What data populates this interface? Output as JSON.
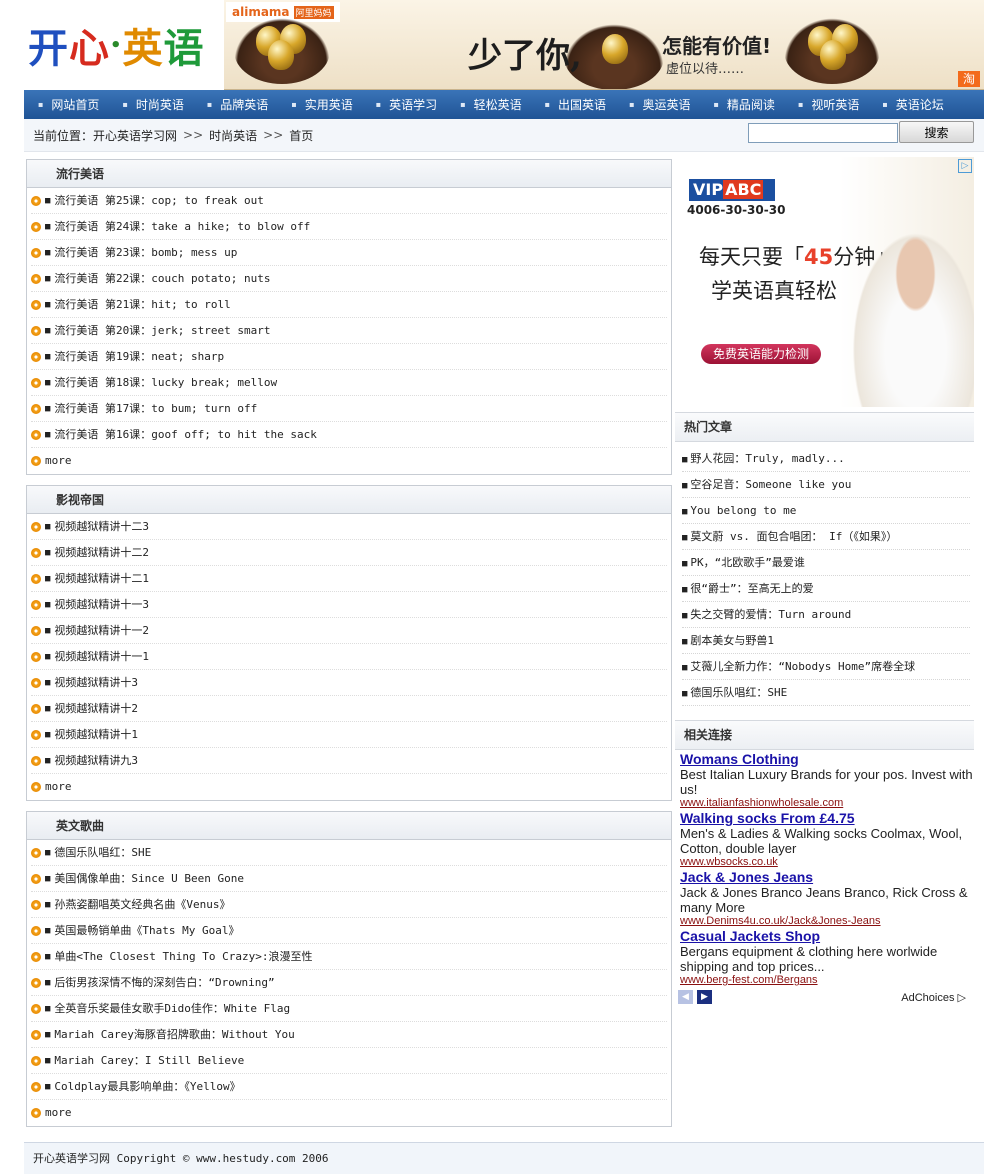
{
  "header": {
    "logo_chars": [
      "开",
      "心",
      "•",
      "英",
      "语"
    ],
    "logo_colors": [
      "#1f4fbf",
      "#d62b1e",
      "#2a8a2a",
      "#e08a00",
      "#1f9a3a"
    ],
    "banner": {
      "alimama": "alimama",
      "alimama_sub": "阿里妈妈",
      "slogan_main": "少了你,",
      "slogan_side": "怎能有价值!",
      "slogan_sub": "虚位以待……",
      "taobao_badge": "淘"
    }
  },
  "nav": [
    "网站首页",
    "时尚英语",
    "品牌英语",
    "实用英语",
    "英语学习",
    "轻松英语",
    "出国英语",
    "奥运英语",
    "精品阅读",
    "视听英语",
    "英语论坛"
  ],
  "location": {
    "label": "当前位置：",
    "crumbs": [
      "开心英语学习网",
      "时尚英语",
      "首页"
    ],
    "separator": ">>",
    "search_button": "搜索",
    "search_value": ""
  },
  "sections": [
    {
      "title": "流行美语",
      "items": [
        "流行美语 第25课：cop; to freak out",
        "流行美语 第24课：take a hike; to blow off",
        "流行美语 第23课：bomb; mess up",
        "流行美语 第22课：couch potato; nuts",
        "流行美语 第21课：hit; to roll",
        "流行美语 第20课：jerk; street smart",
        "流行美语 第19课：neat; sharp",
        "流行美语 第18课：lucky break; mellow",
        "流行美语 第17课：to bum; turn off",
        "流行美语 第16课：goof off; to hit the sack"
      ],
      "more": "more"
    },
    {
      "title": "影视帝国",
      "items": [
        "视频越狱精讲十二3",
        "视频越狱精讲十二2",
        "视频越狱精讲十二1",
        "视频越狱精讲十一3",
        "视频越狱精讲十一2",
        "视频越狱精讲十一1",
        "视频越狱精讲十3",
        "视频越狱精讲十2",
        "视频越狱精讲十1",
        "视频越狱精讲九3"
      ],
      "more": "more"
    },
    {
      "title": "英文歌曲",
      "items": [
        "德国乐队唱红：SHE",
        "美国偶像单曲：Since U Been Gone",
        "孙燕姿翻唱英文经典名曲《Venus》",
        "英国最畅销单曲《Thats My Goal》",
        "单曲<The Closest Thing To Crazy>:浪漫至性",
        "后街男孩深情不悔的深刻告白：“Drowning”",
        "全英音乐奖最佳女歌手Dido佳作：White Flag",
        "Mariah Carey海豚音招牌歌曲：Without You",
        "Mariah Carey：I Still Believe",
        "Coldplay最具影响单曲：《Yellow》"
      ],
      "more": "more"
    }
  ],
  "vip_ad": {
    "logo_vip": "VIP",
    "logo_abc": "ABC",
    "phone": "4006-30-30-30",
    "line1_pre": "每天只要「",
    "line1_num": "45",
    "line1_post": "分钟」",
    "line2": "学英语真轻松",
    "button": "免费英语能力检测",
    "ad_badge": "▷"
  },
  "hot": {
    "title": "热门文章",
    "items": [
      "野人花园：Truly, madly...",
      "空谷足音：Someone like you",
      "You belong to me",
      "莫文蔚 vs. 面包合唱团： If（《如果》）",
      "PK，“北欧歌手”最爱谁",
      "很“爵士”：至高无上的爱",
      "失之交臂的爱情：Turn around",
      "剧本美女与野兽1",
      "艾薇儿全新力作：“Nobodys Home”席卷全球",
      "德国乐队唱红：SHE"
    ]
  },
  "related": {
    "title": "相关连接",
    "links": [
      {
        "title": "Womans Clothing",
        "desc": "Best Italian Luxury Brands for your pos. Invest with us!",
        "url": "www.italianfashionwholesale.com"
      },
      {
        "title": "Walking socks From £4.75",
        "desc": "Men's & Ladies & Walking socks Coolmax, Wool, Cotton, double layer",
        "url": "www.wbsocks.co.uk"
      },
      {
        "title": "Jack & Jones Jeans",
        "desc": "Jack & Jones Branco Jeans Branco, Rick Cross & many More",
        "url": "www.Denims4u.co.uk/Jack&Jones-Jeans"
      },
      {
        "title": "Casual Jackets Shop",
        "desc": "Bergans equipment & clothing here worlwide shipping and top prices...",
        "url": "www.berg-fest.com/Bergans"
      }
    ],
    "adchoices": "AdChoices ▷"
  },
  "footer": "开心英语学习网 Copyright © www.hestudy.com 2006"
}
